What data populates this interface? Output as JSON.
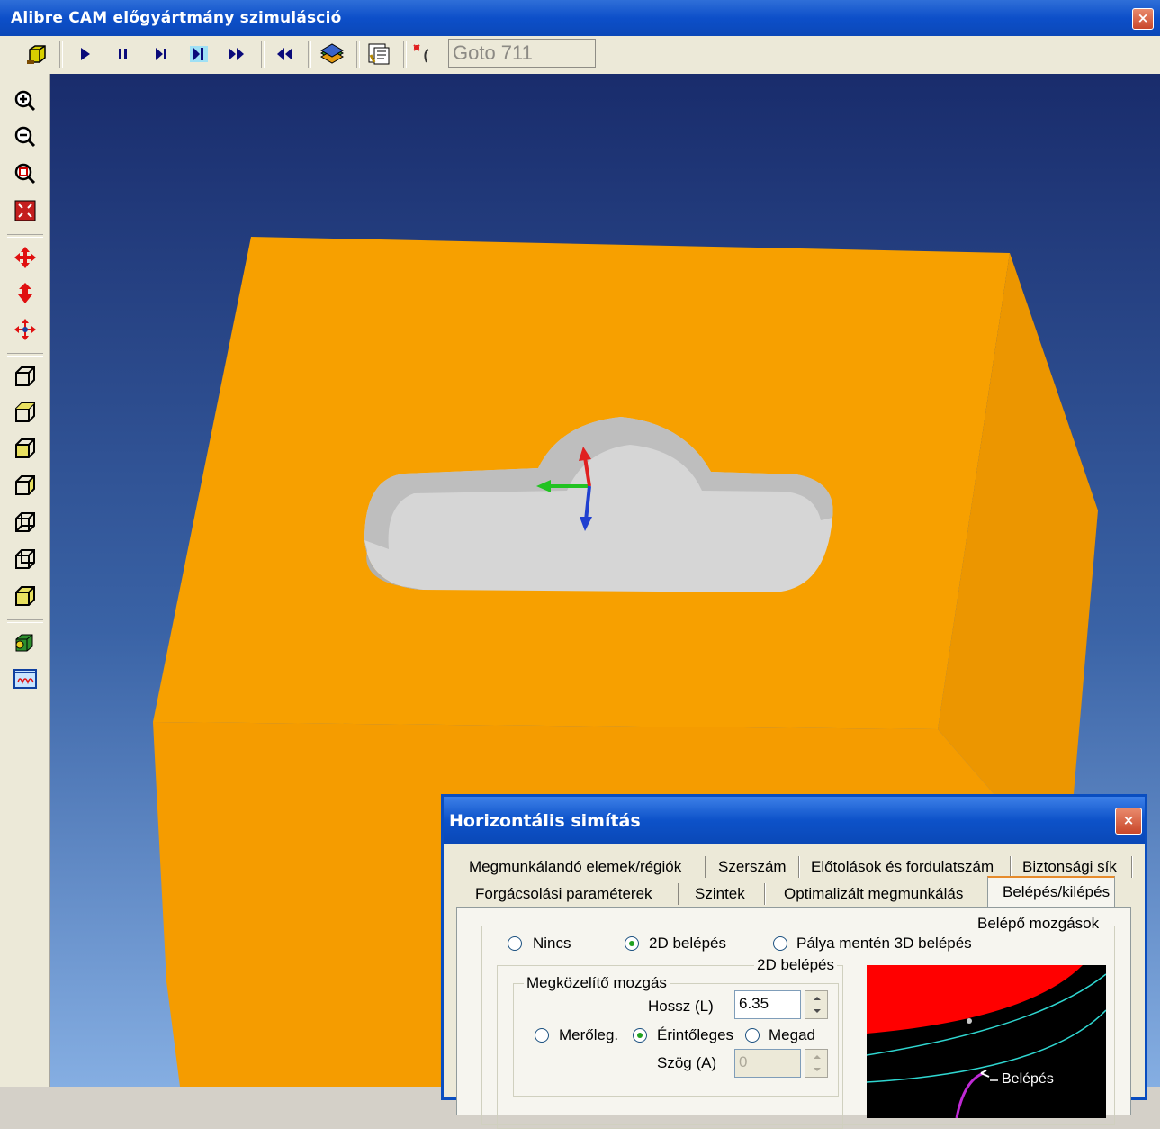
{
  "window": {
    "title": "Alibre CAM előgyártmány szimulásció",
    "close": "×"
  },
  "toolbar": {
    "goto_text": "Goto 711"
  },
  "colors": {
    "stock": "#f69b00",
    "part": "#d9d9d9",
    "titlebar": "#0b4fc6",
    "preview_red": "#ff0000",
    "preview_bg": "#000000",
    "preview_curve": "#2fd6d0"
  },
  "icons": {
    "toolbar": [
      "stock-box-icon",
      "play-icon",
      "pause-icon",
      "step-icon",
      "step-to-icon",
      "fast-forward-icon",
      "rewind-icon",
      "layers-icon",
      "properties-icon",
      "goto-marker-icon"
    ],
    "sidebar": [
      "zoom-in-icon",
      "zoom-out-icon",
      "zoom-window-icon",
      "zoom-fit-icon",
      "pan-icon",
      "rotate-icon",
      "move-icon",
      "view-iso-icon",
      "view-top-icon",
      "view-front-icon",
      "view-right-icon",
      "view-left-icon",
      "view-back-icon",
      "view-solid-icon",
      "render-icon",
      "toolpath-view-icon"
    ]
  },
  "dialog": {
    "title": "Horizontális simítás",
    "close": "×",
    "tabs_row1": [
      "Megmunkálandó elemek/régiók",
      "Szerszám",
      "Előtolások és fordulatszám",
      "Biztonsági sík"
    ],
    "tabs_row2": [
      "Forgácsolási paraméterek",
      "Szintek",
      "Optimalizált megmunkálás",
      "Belépés/kilépés"
    ],
    "active_tab": "Belépés/kilépés",
    "entry_group": {
      "label": "Belépő mozgások",
      "options": [
        "Nincs",
        "2D belépés",
        "Pálya mentén 3D belépés"
      ],
      "selected": "2D belépés"
    },
    "entry_2d": {
      "label": "2D belépés",
      "approach": {
        "label": "Megközelítő mozgás",
        "length_label": "Hossz (L)",
        "length_value": "6.35",
        "modes": [
          "Merőleg.",
          "Érintőleges",
          "Megad"
        ],
        "selected_mode": "Érintőleges",
        "angle_label": "Szög (A)",
        "angle_value": "0"
      },
      "preview_label": "Belépés"
    }
  }
}
